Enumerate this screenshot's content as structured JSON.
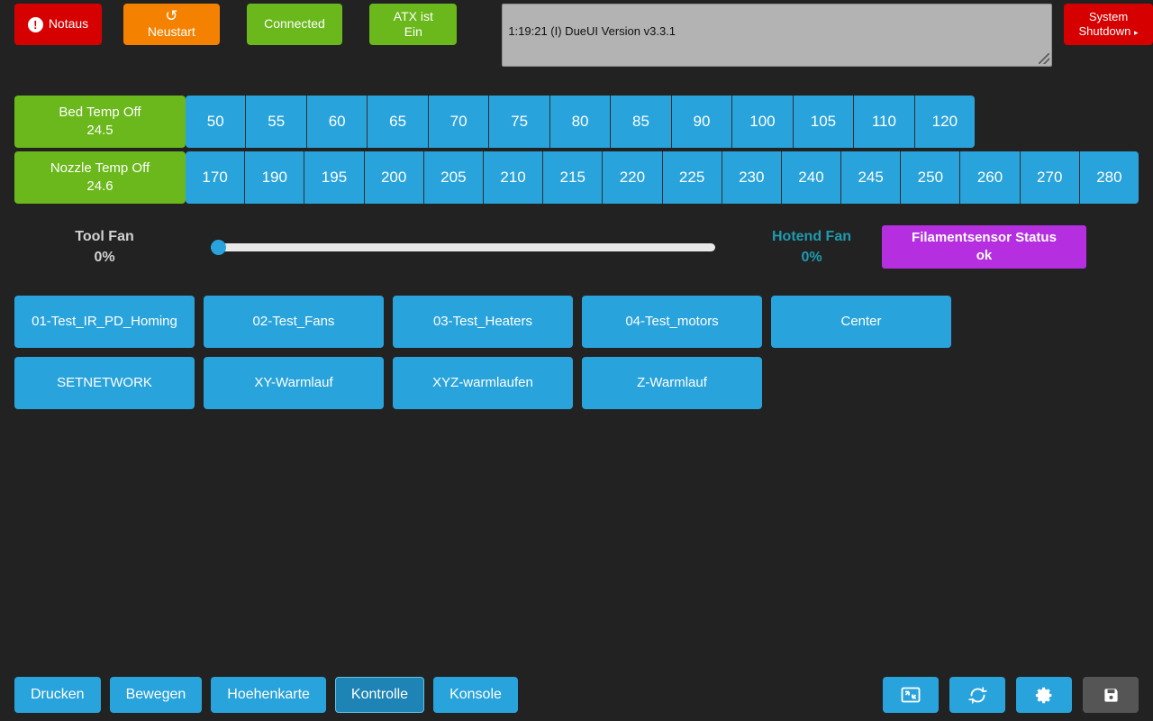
{
  "topbar": {
    "estop": {
      "label": "Notaus",
      "icon": "exclamation-circle-icon",
      "glyph": "!",
      "color": "#d60000"
    },
    "restart": {
      "label": "Neustart",
      "icon": "rotate-ccw-icon",
      "glyph": "↺",
      "color": "#f48200"
    },
    "connection": {
      "label": "Connected",
      "color": "#6ab81b"
    },
    "atx": {
      "label": "ATX ist\nEin",
      "line1": "ATX ist",
      "line2": "Ein",
      "color": "#6ab81b"
    },
    "console": {
      "text": "1:19:21 (I) DueUI Version v3.3.1",
      "placeholder": ""
    },
    "shutdown": {
      "line1": "System",
      "line2": "Shutdown",
      "caret": "▸",
      "color": "#d60000"
    }
  },
  "heaters": [
    {
      "name": "bed",
      "label_line1": "Bed Temp Off",
      "label_line2": "24.5",
      "head_color": "#6ab81b",
      "presets": [
        "50",
        "55",
        "60",
        "65",
        "70",
        "75",
        "80",
        "85",
        "90",
        "100",
        "105",
        "110",
        "120"
      ]
    },
    {
      "name": "nozzle",
      "label_line1": "Nozzle Temp Off",
      "label_line2": "24.6",
      "head_color": "#6ab81b",
      "presets": [
        "170",
        "190",
        "195",
        "200",
        "205",
        "210",
        "215",
        "220",
        "225",
        "230",
        "240",
        "245",
        "250",
        "260",
        "270",
        "280"
      ]
    }
  ],
  "fans": {
    "tool": {
      "label": "Tool Fan",
      "value": "0%",
      "color": "#d2d2d2",
      "slider_percent": 0
    },
    "hotend": {
      "label": "Hotend Fan",
      "value": "0%",
      "color": "#1f9ab0"
    }
  },
  "filament_sensor": {
    "label": "Filamentsensor Status",
    "value": "ok",
    "color": "#b52fe0"
  },
  "macros": [
    {
      "label": "01-Test_IR_PD_Homing"
    },
    {
      "label": "02-Test_Fans"
    },
    {
      "label": "03-Test_Heaters"
    },
    {
      "label": "04-Test_motors"
    },
    {
      "label": "Center"
    },
    {
      "label": "SETNETWORK"
    },
    {
      "label": "XY-Warmlauf"
    },
    {
      "label": "XYZ-warmlaufen"
    },
    {
      "label": "Z-Warmlauf"
    }
  ],
  "nav": {
    "tabs": [
      {
        "label": "Drucken",
        "active": false
      },
      {
        "label": "Bewegen",
        "active": false
      },
      {
        "label": "Hoehenkarte",
        "active": false
      },
      {
        "label": "Kontrolle",
        "active": true
      },
      {
        "label": "Konsole",
        "active": false
      }
    ],
    "icons": [
      {
        "name": "restore-window-icon",
        "enabled": true
      },
      {
        "name": "refresh-icon",
        "enabled": true
      },
      {
        "name": "gear-icon",
        "enabled": true
      },
      {
        "name": "save-icon",
        "enabled": false
      }
    ]
  },
  "theme": {
    "background": "#222222",
    "accent_blue": "#29a3db",
    "accent_green": "#6ab81b",
    "accent_red": "#d60000",
    "accent_orange": "#f48200",
    "accent_purple": "#b52fe0"
  }
}
